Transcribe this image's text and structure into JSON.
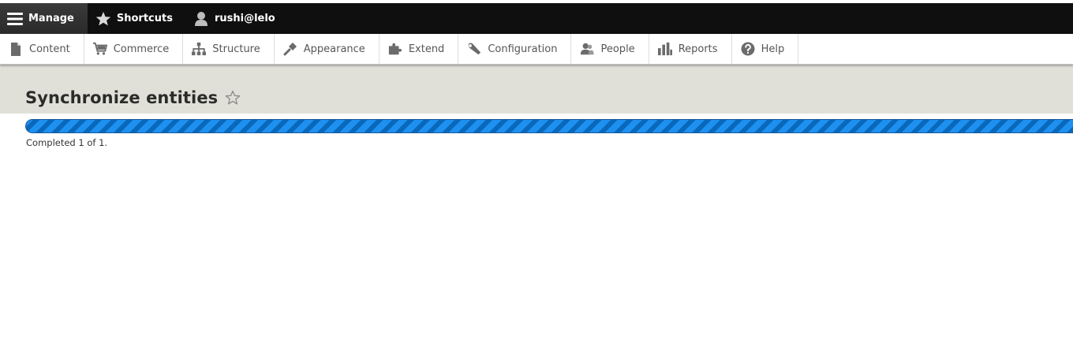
{
  "toolbar": {
    "manage_label": "Manage",
    "shortcuts_label": "Shortcuts",
    "user_label": "rushi@lelo"
  },
  "tray": {
    "items": [
      {
        "label": "Content",
        "icon": "file-icon"
      },
      {
        "label": "Commerce",
        "icon": "cart-icon"
      },
      {
        "label": "Structure",
        "icon": "sitemap-icon"
      },
      {
        "label": "Appearance",
        "icon": "paint-icon"
      },
      {
        "label": "Extend",
        "icon": "puzzle-icon"
      },
      {
        "label": "Configuration",
        "icon": "wrench-icon"
      },
      {
        "label": "People",
        "icon": "people-icon"
      },
      {
        "label": "Reports",
        "icon": "bar-chart-icon"
      },
      {
        "label": "Help",
        "icon": "help-icon"
      }
    ]
  },
  "page": {
    "title": "Synchronize entities"
  },
  "progress": {
    "percent": 100,
    "message": "Completed 1 of 1."
  },
  "colors": {
    "toolbar_bg": "#0f0f0f",
    "header_bg": "#e0e0d8",
    "progress_blue": "#0b7ad6"
  }
}
